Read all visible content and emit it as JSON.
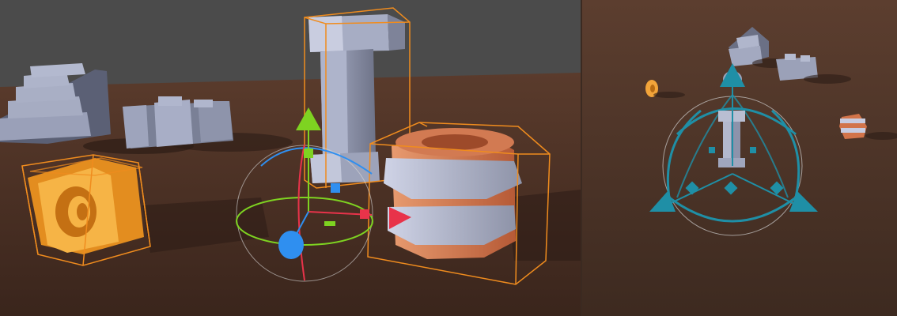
{
  "colors": {
    "sky": "#4a4a4a",
    "ground_far": "#4e3427",
    "ground_near": "#3a261d",
    "selection_outline": "#f08c1e",
    "gizmo_x": "#e8334a",
    "gizmo_y": "#7ed321",
    "gizmo_z": "#2f8ff0",
    "gizmo_alt": "#1f8fa6",
    "stone": "#9aa0b8",
    "terracotta": "#d2744a",
    "gold": "#f2a43a"
  },
  "viewports": {
    "left": {
      "tool": "rotate-translate-combined",
      "selected_objects": [
        "pillar",
        "barrel",
        "ring"
      ]
    },
    "right": {
      "tool": "universal-transform",
      "selected_objects": [
        "small-pillar"
      ]
    }
  },
  "icons": [
    "arrow-up-icon",
    "arrow-right-icon",
    "arrow-forward-icon",
    "plane-handle-icon",
    "rotate-ring-icon"
  ]
}
